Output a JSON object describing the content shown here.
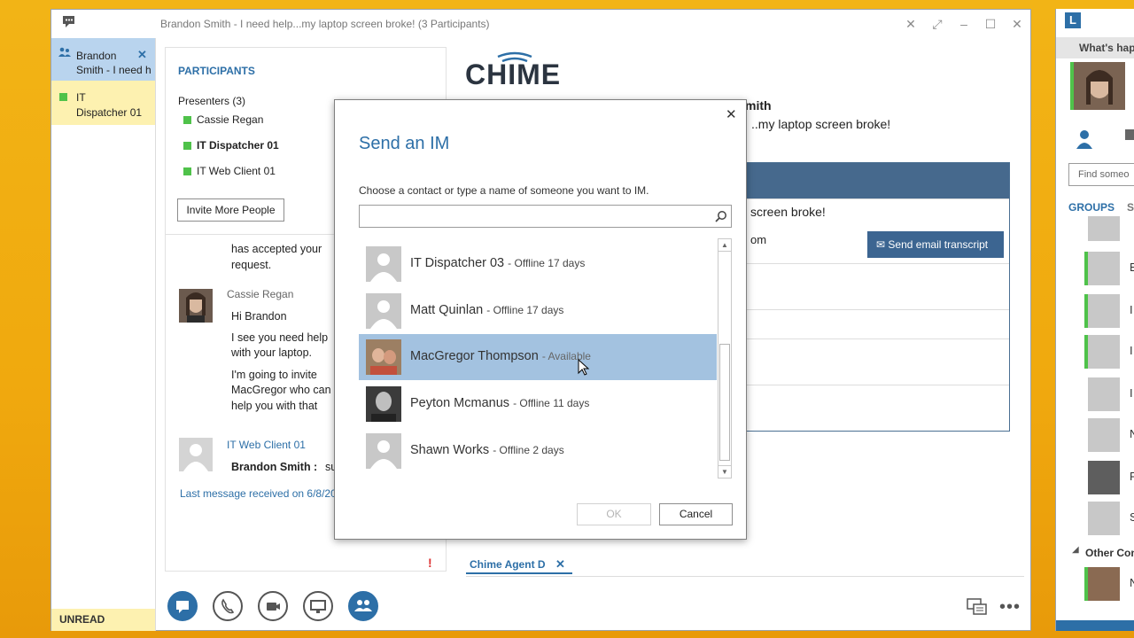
{
  "window": {
    "title": "Brandon Smith - I need help...my laptop screen broke! (3 Participants)"
  },
  "tabs": [
    {
      "line1": "Brandon",
      "line2": "Smith - I need h"
    },
    {
      "line1": "IT",
      "line2": "Dispatcher 01"
    }
  ],
  "unread_label": "UNREAD",
  "participants": {
    "heading": "PARTICIPANTS",
    "group_label": "Presenters (3)",
    "people": [
      "Cassie Regan",
      "IT Dispatcher 01",
      "IT Web Client 01"
    ],
    "invite_label": "Invite More People"
  },
  "chat": {
    "accepted_line1": "has accepted your",
    "accepted_line2": "request.",
    "msg1_sender": "Cassie Regan",
    "msg1_lines": [
      "Hi Brandon",
      "I see you need help",
      "with your laptop.",
      "I'm going to invite",
      "MacGregor who can",
      "help you with that"
    ],
    "msg2_sender": "IT Web Client 01",
    "msg2_name": "Brandon Smith :",
    "msg2_text": "su",
    "last_message": "Last message received on 6/8/20",
    "alert_mark": "!"
  },
  "right": {
    "logo": "CHIME",
    "header_name": "mith",
    "header_subject": "..my laptop screen broke!",
    "card_line1": "screen broke!",
    "card_line2": "om",
    "email_button": "Send email transcript",
    "agent_tab": "Chime Agent D"
  },
  "dialog": {
    "title": "Send an IM",
    "prompt": "Choose a contact or type a name of someone you want to IM.",
    "search_value": "",
    "contacts": [
      {
        "name": "IT Dispatcher 03",
        "status": "- Offline 17 days"
      },
      {
        "name": "Matt Quinlan",
        "status": "- Offline 17 days"
      },
      {
        "name": "MacGregor Thompson",
        "status": "- Available"
      },
      {
        "name": "Peyton Mcmanus",
        "status": "- Offline 11 days"
      },
      {
        "name": "Shawn Works",
        "status": "- Offline 2 days"
      }
    ],
    "ok_label": "OK",
    "cancel_label": "Cancel"
  },
  "side": {
    "header": "What's hap",
    "search_placeholder": "Find someo",
    "groups_label": "GROUPS",
    "groups_s": "S",
    "other_contacts": "Other Con",
    "letters": [
      "B",
      "I",
      "I",
      "I",
      "N",
      "F",
      "S",
      "N"
    ]
  },
  "colors": {
    "accent": "#2d6fa7",
    "available": "#4fc24a",
    "selection": "#a3c2e0"
  }
}
